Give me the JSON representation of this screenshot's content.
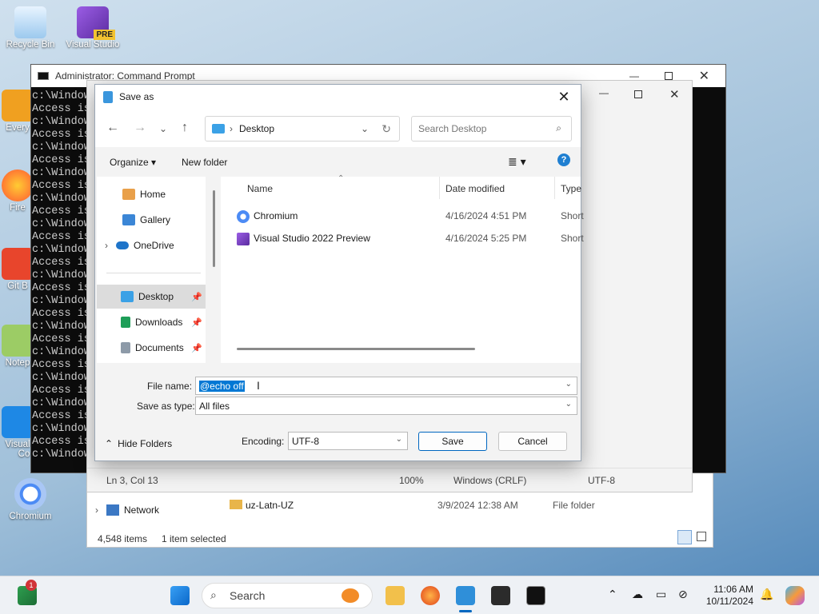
{
  "desktop": {
    "icons": [
      {
        "label": "Recycle Bin"
      },
      {
        "label": "Visual Studio"
      },
      {
        "label": "Every"
      },
      {
        "label": "Fire"
      },
      {
        "label": "Git B"
      },
      {
        "label": "Notep"
      },
      {
        "label": "Visual"
      },
      {
        "label": "Co"
      },
      {
        "label": "Chromium"
      }
    ],
    "vs_badge": "PRE"
  },
  "cmd": {
    "title": "Administrator: Command Prompt",
    "lines": [
      "c:\\Window",
      "Access is",
      "c:\\Window",
      "Access is",
      "c:\\Window",
      "Access is",
      "c:\\Window",
      "Access is",
      "c:\\Window",
      "Access is",
      "c:\\Window",
      "Access is",
      "c:\\Window",
      "Access is",
      "c:\\Window",
      "Access is",
      "c:\\Window",
      "Access is",
      "c:\\Window",
      "Access is",
      "c:\\Window",
      "Access is",
      "c:\\Window",
      "Access is",
      "c:\\Window",
      "Access is",
      "c:\\Window",
      "Access is",
      "c:\\Window"
    ]
  },
  "notepad_status": {
    "position": "Ln 3, Col 13",
    "zoom": "100%",
    "line_ending": "Windows (CRLF)",
    "encoding": "UTF-8"
  },
  "explorer_bg": {
    "nav_network": "Network",
    "row_name": "uz-Latn-UZ",
    "row_date": "3/9/2024 12:38 AM",
    "row_type": "File folder",
    "items_count": "4,548 items",
    "selected_count": "1 item selected"
  },
  "dialog": {
    "title": "Save as",
    "breadcrumb": "Desktop",
    "search_placeholder": "Search Desktop",
    "toolbar": {
      "organize": "Organize",
      "new_folder": "New folder"
    },
    "nav": [
      {
        "label": "Home"
      },
      {
        "label": "Gallery"
      },
      {
        "label": "OneDrive"
      },
      {
        "label": "Desktop"
      },
      {
        "label": "Downloads"
      },
      {
        "label": "Documents"
      }
    ],
    "columns": {
      "name": "Name",
      "date": "Date modified",
      "type": "Type"
    },
    "files": [
      {
        "name": "Chromium",
        "date": "4/16/2024 4:51 PM",
        "type": "Short"
      },
      {
        "name": "Visual Studio 2022 Preview",
        "date": "4/16/2024 5:25 PM",
        "type": "Short"
      }
    ],
    "file_name_label": "File name:",
    "file_name_value": "@echo off",
    "save_type_label": "Save as type:",
    "save_type_value": "All files",
    "hide_folders": "Hide Folders",
    "encoding_label": "Encoding:",
    "encoding_value": "UTF-8",
    "save_button": "Save",
    "cancel_button": "Cancel"
  },
  "taskbar": {
    "search_placeholder": "Search",
    "notification_badge": "1",
    "time": "11:06 AM",
    "date": "10/11/2024"
  }
}
